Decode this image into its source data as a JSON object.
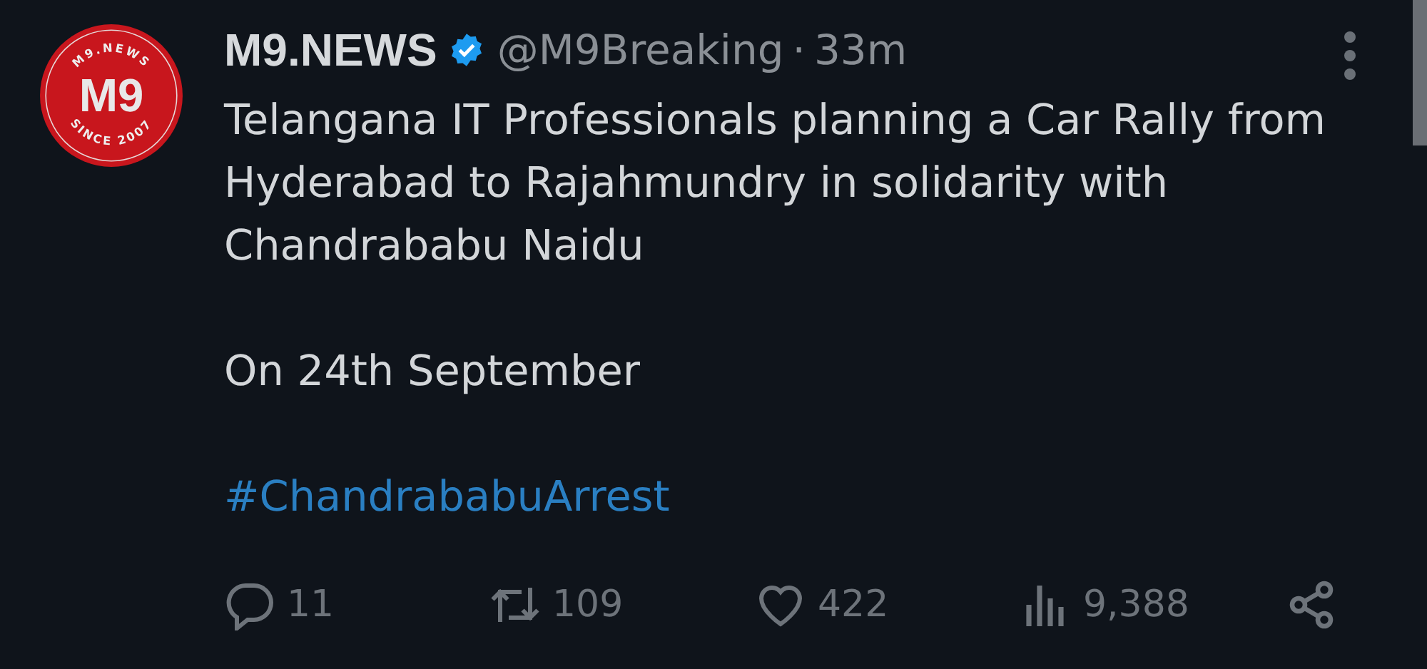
{
  "avatar": {
    "ring_top": "M9.NEWS",
    "center": "M9",
    "ring_bottom": "SINCE 2007"
  },
  "author": {
    "name": "M9.NEWS",
    "verified": true,
    "handle": "@M9Breaking",
    "separator": "·",
    "time": "33m"
  },
  "body": [
    {
      "kind": "text",
      "text": "Telangana IT Professionals planning a Car Rally from Hyderabad to Rajahmundry in solidarity with Chandrababu Naidu"
    },
    {
      "kind": "text",
      "text": "On 24th September"
    },
    {
      "kind": "hashtag",
      "text": "#ChandrababuArrest"
    }
  ],
  "actions": [
    {
      "kind": "reply",
      "count": "11"
    },
    {
      "kind": "retweet",
      "count": "109"
    },
    {
      "kind": "like",
      "count": "422"
    },
    {
      "kind": "views",
      "count": "9,388"
    },
    {
      "kind": "share"
    }
  ]
}
